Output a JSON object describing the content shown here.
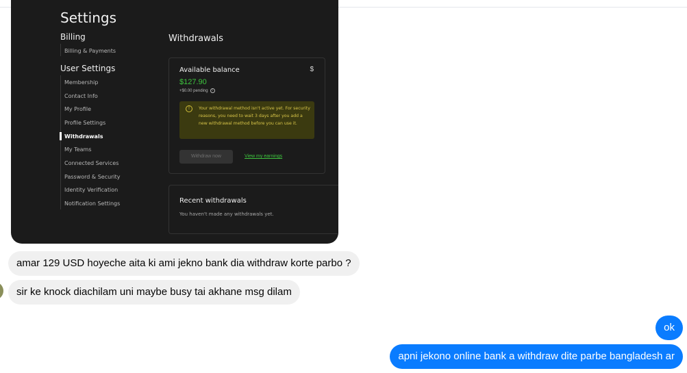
{
  "screenshot": {
    "title": "Settings",
    "sections": [
      {
        "heading": "Billing",
        "items": [
          "Billing & Payments"
        ]
      },
      {
        "heading": "User Settings",
        "items": [
          "Membership",
          "Contact Info",
          "My Profile",
          "Profile Settings",
          "Withdrawals",
          "My Teams",
          "Connected Services",
          "Password & Security",
          "Identity Verification",
          "Notification Settings"
        ]
      }
    ],
    "active_item": "Withdrawals",
    "page_heading": "Withdrawals",
    "balance_card": {
      "title": "Available balance",
      "currency_symbol": "$",
      "amount": "$127.90",
      "pending": "+$0.00 pending",
      "warning": "Your withdrawal method isn't active yet. For security reasons, you need to wait 3 days after you add a new withdrawal method before you can use it.",
      "withdraw_button": "Withdraw now",
      "earnings_link": "View my earnings"
    },
    "recent_card": {
      "title": "Recent withdrawals",
      "empty_text": "You haven't made any withdrawals yet."
    },
    "colors": {
      "accent_green": "#3ec43e",
      "warning_bg": "#3b3a10",
      "warning_text": "#d9c649"
    }
  },
  "messages": [
    {
      "direction": "incoming",
      "text": "amar 129 USD hoyeche aita ki ami jekno bank dia withdraw korte parbo ?"
    },
    {
      "direction": "incoming",
      "text": "sir ke knock diachilam uni maybe busy tai akhane msg dilam"
    },
    {
      "direction": "outgoing",
      "text": "ok"
    },
    {
      "direction": "outgoing",
      "text": "apni jekono online bank a withdraw dite parbe bangladesh ar"
    }
  ],
  "colors": {
    "outgoing_bubble": "#0a7cff",
    "incoming_bubble": "#f0f0f0"
  }
}
